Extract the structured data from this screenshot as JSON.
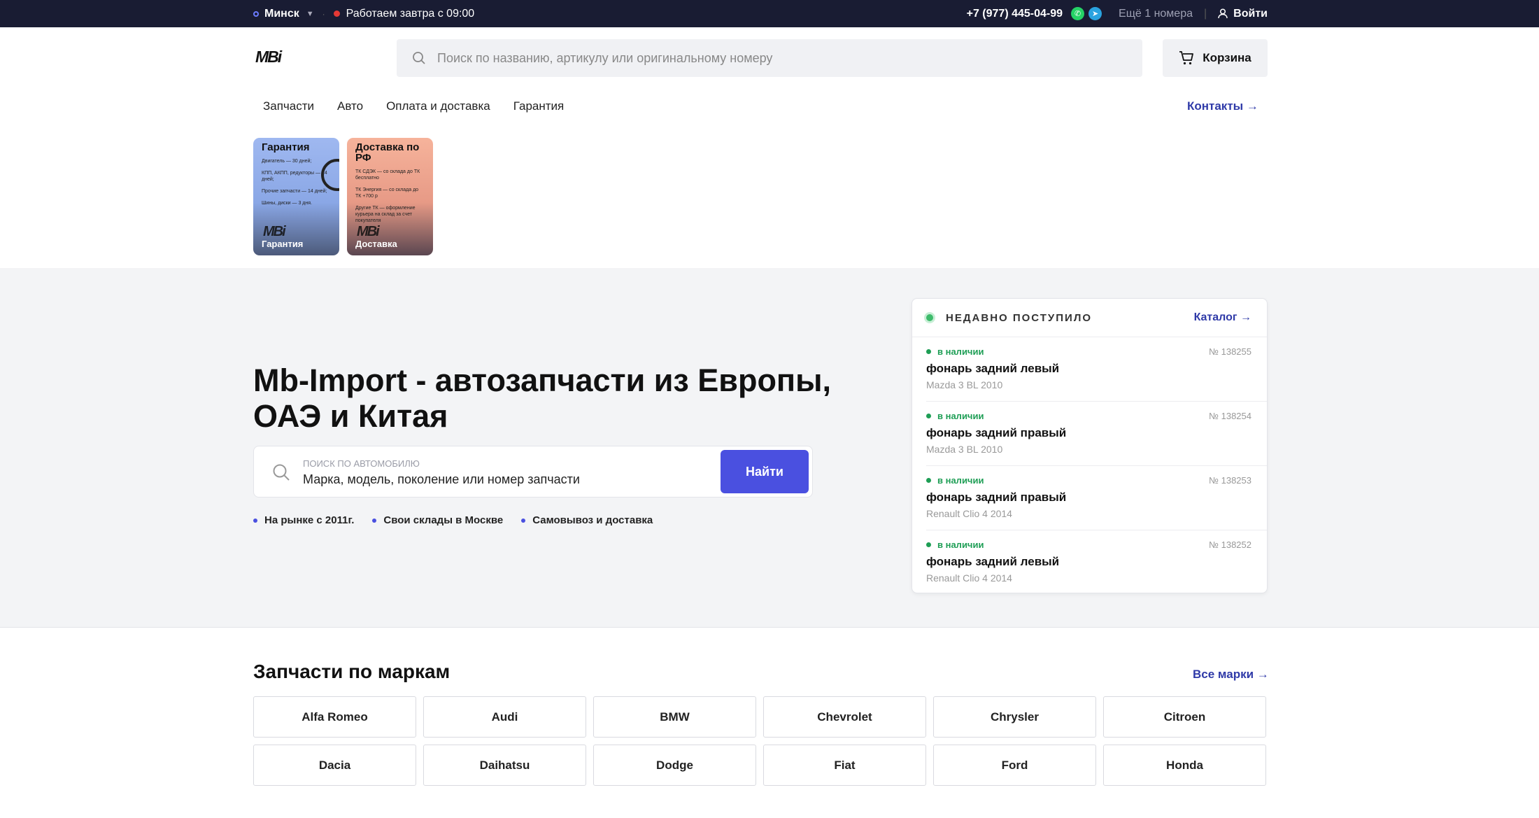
{
  "topbar": {
    "city": "Минск",
    "schedule": "Работаем завтра с 09:00",
    "phone": "+7 (977) 445-04-99",
    "more_phones": "Ещё 1 номера",
    "login": "Войти"
  },
  "header": {
    "logo": "MBi",
    "search_placeholder": "Поиск по названию, артикулу или оригинальному номеру",
    "cart": "Корзина"
  },
  "nav": {
    "items": [
      "Запчасти",
      "Авто",
      "Оплата и доставка",
      "Гарантия"
    ],
    "contacts": "Контакты →"
  },
  "stories": [
    {
      "title": "Гарантия",
      "lines": [
        "Двигатель — 30 дней;",
        "КПП, АКПП, редукторы — 14 дней;",
        "Прочие запчасти — 14 дней;",
        "Шины, диски — 3 дня."
      ],
      "caption": "Гарантия"
    },
    {
      "title": "Доставка по РФ",
      "lines": [
        "ТК СДЭК — со склада до ТК бесплатно",
        "ТК Энергия — со склада до ТК +700 р",
        "Другие ТК — оформление курьера на склад за счет покупателя"
      ],
      "caption": "Доставка"
    }
  ],
  "hero": {
    "title": "Mb-Import - автозапчасти из Европы, ОАЭ и Китая",
    "search_label": "ПОИСК ПО АВТОМОБИЛЮ",
    "search_value": "Марка, модель, поколение или номер запчасти",
    "button": "Найти",
    "features": [
      "На рынке с 2011г.",
      "Свои склады в Москве",
      "Самовывоз и доставка"
    ]
  },
  "recent": {
    "title": "НЕДАВНО ПОСТУПИЛО",
    "catalog": "Каталог →",
    "items": [
      {
        "status": "в наличии",
        "num": "№ 138255",
        "name": "фонарь задний левый",
        "car": "Mazda 3 BL 2010"
      },
      {
        "status": "в наличии",
        "num": "№ 138254",
        "name": "фонарь задний правый",
        "car": "Mazda 3 BL 2010"
      },
      {
        "status": "в наличии",
        "num": "№ 138253",
        "name": "фонарь задний правый",
        "car": "Renault Clio 4 2014"
      },
      {
        "status": "в наличии",
        "num": "№ 138252",
        "name": "фонарь задний левый",
        "car": "Renault Clio 4 2014"
      }
    ]
  },
  "brands": {
    "title": "Запчасти по маркам",
    "all": "Все марки →",
    "items": [
      "Alfa Romeo",
      "Audi",
      "BMW",
      "Chevrolet",
      "Chrysler",
      "Citroen",
      "Dacia",
      "Daihatsu",
      "Dodge",
      "Fiat",
      "Ford",
      "Honda"
    ]
  },
  "colors": {
    "accent": "#4a50e0",
    "link": "#2f3aa8",
    "topbar": "#191c33",
    "instock": "#1e9e55"
  }
}
